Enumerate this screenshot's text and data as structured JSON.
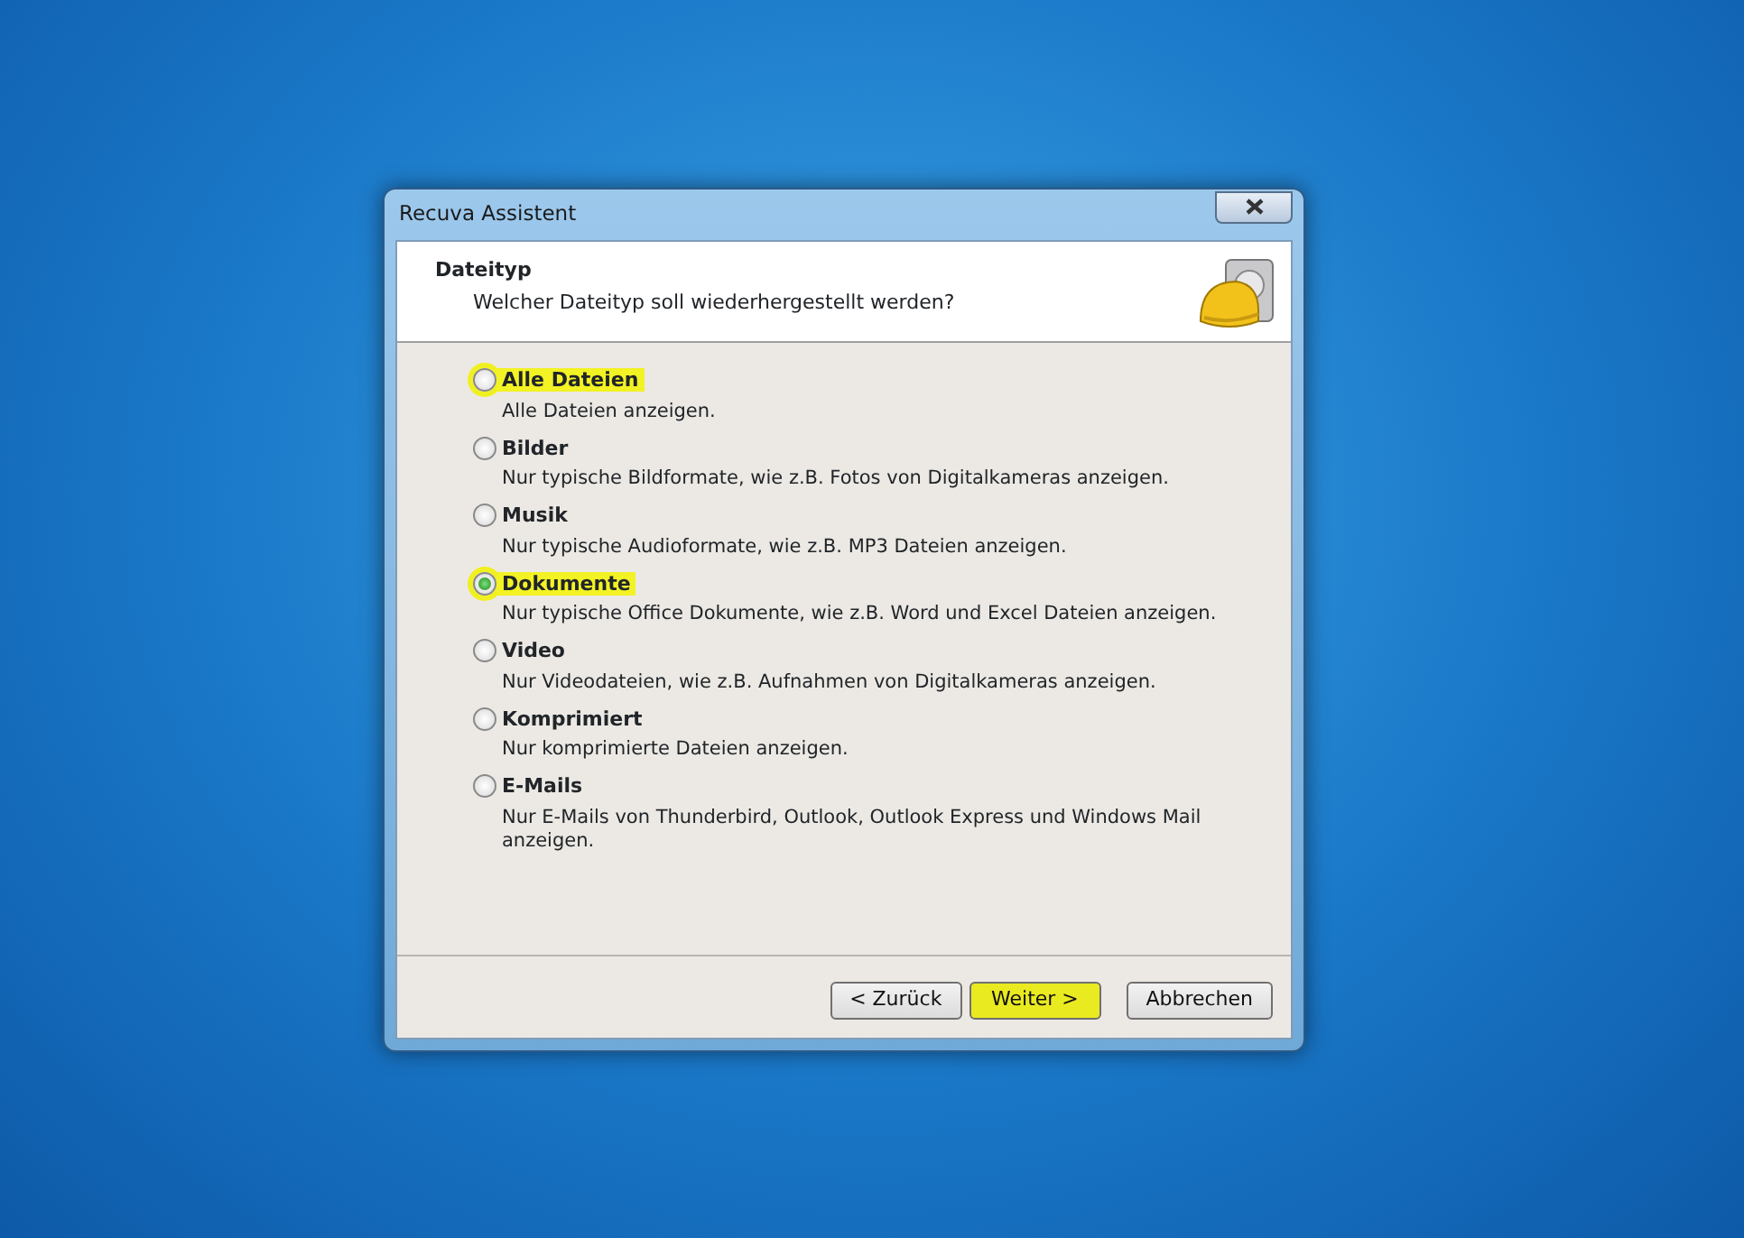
{
  "window": {
    "title": "Recuva Assistent"
  },
  "header": {
    "title": "Dateityp",
    "subtitle": "Welcher Dateityp soll wiederhergestellt werden?"
  },
  "options": [
    {
      "label": "Alle Dateien",
      "description": "Alle Dateien anzeigen.",
      "selected": false,
      "highlighted": true
    },
    {
      "label": "Bilder",
      "description": "Nur typische Bildformate, wie z.B. Fotos von Digitalkameras anzeigen.",
      "selected": false,
      "highlighted": false
    },
    {
      "label": "Musik",
      "description": "Nur typische Audioformate, wie z.B. MP3 Dateien anzeigen.",
      "selected": false,
      "highlighted": false
    },
    {
      "label": "Dokumente",
      "description": "Nur typische Office Dokumente, wie z.B. Word und Excel Dateien anzeigen.",
      "selected": true,
      "highlighted": true
    },
    {
      "label": "Video",
      "description": "Nur Videodateien, wie z.B. Aufnahmen von Digitalkameras anzeigen.",
      "selected": false,
      "highlighted": false
    },
    {
      "label": "Komprimiert",
      "description": "Nur komprimierte Dateien anzeigen.",
      "selected": false,
      "highlighted": false
    },
    {
      "label": "E-Mails",
      "description": "Nur E-Mails von Thunderbird, Outlook, Outlook Express und Windows Mail anzeigen.",
      "selected": false,
      "highlighted": false
    }
  ],
  "buttons": [
    {
      "label": "< Zurück",
      "highlighted": false
    },
    {
      "label": "Weiter >",
      "highlighted": true
    },
    {
      "label": "Abbrechen",
      "highlighted": false
    }
  ]
}
